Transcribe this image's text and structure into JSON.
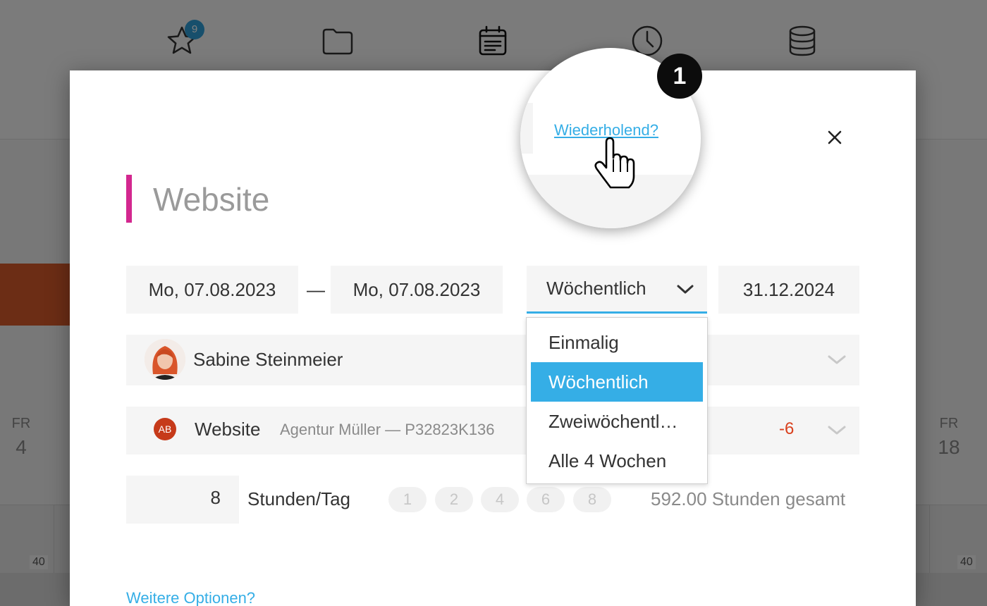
{
  "background": {
    "nav": {
      "badge_count": "9",
      "icons": [
        "star-icon",
        "folder-icon",
        "calendar-icon",
        "clock-icon",
        "database-icon"
      ]
    },
    "days": [
      {
        "name": "FR",
        "date": "4"
      },
      {
        "name": "FR",
        "date": "18"
      }
    ],
    "capacity_values": [
      "40",
      "40"
    ]
  },
  "modal": {
    "title": "Website",
    "title_accent_color": "#d3278f",
    "repeat_link": "Wiederholend?",
    "start_date": "Mo, 07.08.2023",
    "date_separator": "—",
    "end_date": "Mo, 07.08.2023",
    "recurrence": {
      "selected": "Wöchentlich",
      "options": [
        "Einmalig",
        "Wöchentlich",
        "Zweiwöchentl…",
        "Alle 4 Wochen"
      ]
    },
    "recurrence_end": "31.12.2024",
    "person": {
      "name": "Sabine Steinmeier"
    },
    "project": {
      "badge": "AB",
      "name": "Website",
      "meta": "Agentur Müller — P32823K136",
      "difference": "-6"
    },
    "hours": {
      "value": "8",
      "unit": "Stunden/Tag",
      "presets": [
        "1",
        "2",
        "4",
        "6",
        "8"
      ],
      "total": "592.00 Stunden gesamt"
    },
    "more_options": "Weitere Optionen?"
  },
  "tutorial": {
    "step": "1"
  },
  "colors": {
    "accent": "#35aee6",
    "negative": "#d9411e",
    "project_badge": "#c63a1a"
  }
}
